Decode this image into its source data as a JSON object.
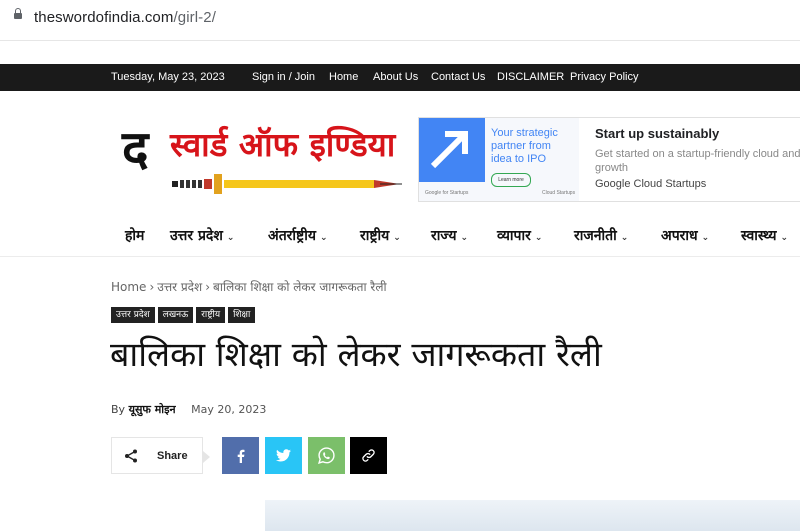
{
  "browser": {
    "url_domain": "theswordofindia.com",
    "url_path": "/girl-2/"
  },
  "topbar": {
    "date": "Tuesday, May 23, 2023",
    "links": [
      "Sign in / Join",
      "Home",
      "About Us",
      "Contact Us",
      "DISCLAIMER",
      "Privacy Policy"
    ]
  },
  "logo": {
    "letter": "द",
    "name": "स्वार्ड ऑफ इण्डिया"
  },
  "ad": {
    "tagline": "Your strategic partner from idea to IPO",
    "button": "Learn more",
    "footer_left": "Google for Startups",
    "footer_right": "Cloud Startups",
    "headline": "Start up sustainably",
    "body": "Get started on a startup-friendly cloud and growth",
    "source": "Google Cloud Startups"
  },
  "nav": {
    "items": [
      "होम",
      "उत्तर प्रदेश",
      "अंतर्राष्ट्रीय",
      "राष्ट्रीय",
      "राज्य",
      "व्यापार",
      "राजनीती",
      "अपराध",
      "स्वास्थ्य"
    ]
  },
  "breadcrumb": [
    "Home",
    "उत्तर प्रदेश",
    "बालिका शिक्षा को लेकर जागरूकता रैली"
  ],
  "tags": [
    "उत्तर प्रदेश",
    "लखनऊ",
    "राष्ट्रीय",
    "शिक्षा"
  ],
  "article": {
    "title": "बालिका शिक्षा को लेकर जागरूकता रैली",
    "by_label": "By",
    "author": "यूसुफ मोइन",
    "date": "May 20, 2023"
  },
  "share": {
    "label": "Share"
  },
  "colors": {
    "facebook": "#516eab",
    "twitter": "#29c5f6",
    "whatsapp": "#7bbf6a",
    "copy": "#000000",
    "logo_red": "#d7141a"
  }
}
